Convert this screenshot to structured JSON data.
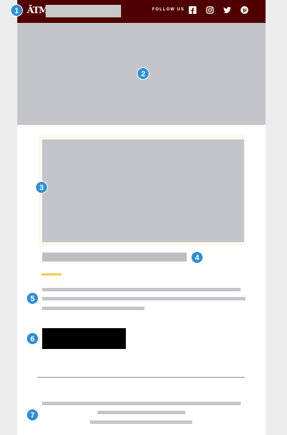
{
  "header": {
    "logo_text": "ĀTM",
    "follow_label": "FOLLOW US",
    "social": [
      {
        "icon": "facebook-icon"
      },
      {
        "icon": "instagram-icon"
      },
      {
        "icon": "twitter-icon"
      },
      {
        "icon": "pinterest-icon"
      }
    ]
  },
  "annotations": [
    "1",
    "2",
    "3",
    "4",
    "5",
    "6",
    "7"
  ],
  "colors": {
    "header_bg": "#500000",
    "placeholder": "#c4c5c8",
    "accent": "#f2c94c",
    "badge": "#2f8fd0",
    "cta": "#000000"
  }
}
